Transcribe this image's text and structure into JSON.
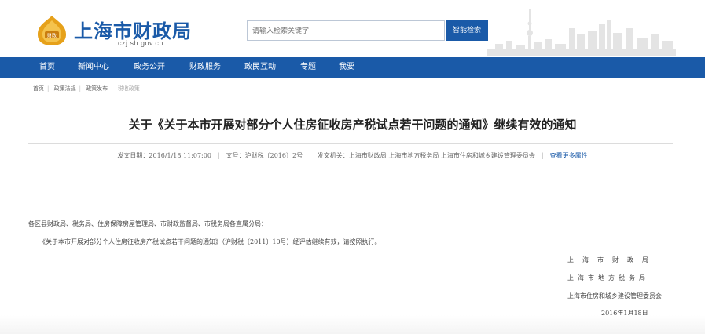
{
  "header": {
    "site_name": "上海市财政局",
    "site_url": "czj.sh.gov.cn",
    "search_placeholder": "请输入检索关键字",
    "search_button": "智能检索",
    "colors": {
      "brand_blue": "#1a5aa8",
      "logo_gold": "#e6a11a"
    }
  },
  "nav": {
    "items": [
      "首页",
      "新闻中心",
      "政务公开",
      "财政服务",
      "政民互动",
      "专题",
      "我要"
    ]
  },
  "breadcrumb": [
    "首页",
    "政策法规",
    "政策发布",
    "税收政策"
  ],
  "article": {
    "title": "关于《关于本市开展对部分个人住房征收房产税试点若干问题的通知》继续有效的通知",
    "meta": {
      "date": "发文日期：2016/1/18 11:07:00",
      "doc_no": "文号：沪财税〔2016〕2号",
      "issuer": "发文机关：上海市财政局  上海市地方税务局  上海市住房和城乡建设管理委员会",
      "more_link": "查看更多属性"
    },
    "salutation": "各区县财政局、税务局、住房保障房屋管理局、市财政监督局、市税务局各直属分局：",
    "paragraph": "《关于本市开展对部分个人住房征收房产税试点若干问题的通知》（沪财税〔2011〕10号）经评估继续有效，请按照执行。",
    "signatures": [
      "上海市财政局",
      "上海市地方税务局",
      "上海市住房和城乡建设管理委员会"
    ],
    "sign_date": "2016年1月18日"
  }
}
